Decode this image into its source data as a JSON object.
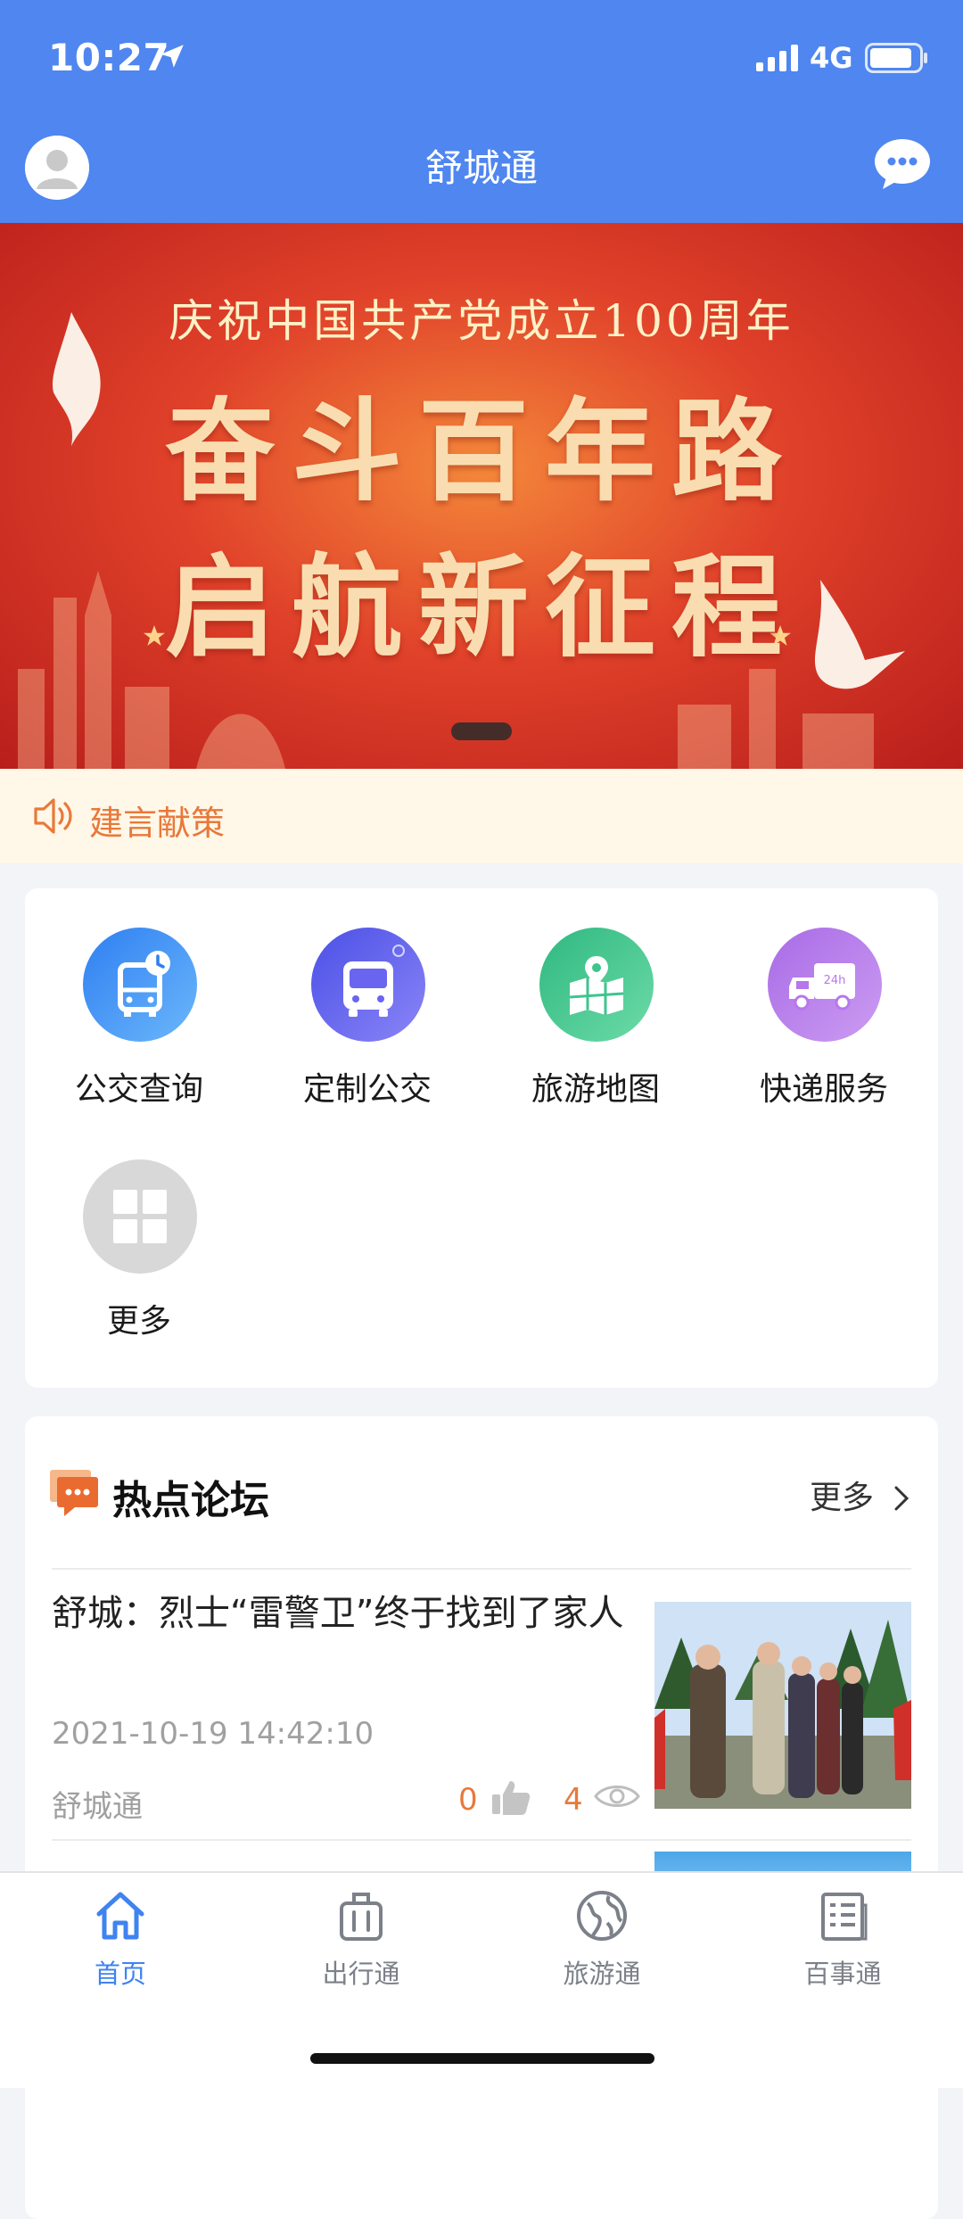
{
  "status_bar": {
    "time": "10:27",
    "network": "4G"
  },
  "header": {
    "title": "舒城通"
  },
  "banner": {
    "subtitle": "庆祝中国共产党成立100周年",
    "line1": "奋斗百年路",
    "line2": "启航新征程"
  },
  "notice": {
    "text": "建言献策"
  },
  "services": [
    {
      "label": "公交查询",
      "icon": "bus-clock-icon",
      "color": "#3d8cf3"
    },
    {
      "label": "定制公交",
      "icon": "bus-icon",
      "color": "#5b63ee"
    },
    {
      "label": "旅游地图",
      "icon": "map-pin-icon",
      "color": "#3dc58f"
    },
    {
      "label": "快递服务",
      "icon": "delivery-truck-icon",
      "color": "#b777ec"
    },
    {
      "label": "更多",
      "icon": "grid-icon",
      "color": "#d8d8d8"
    }
  ],
  "forum": {
    "title": "热点论坛",
    "more": "更多",
    "posts": [
      {
        "title": "舒城：烈士“雷警卫”终于找到了家人",
        "date": "2021-10-19 14:42:10",
        "source": "舒城通",
        "likes": "0",
        "views": "4"
      }
    ]
  },
  "tabs": [
    {
      "label": "首页",
      "icon": "home-icon",
      "active": true
    },
    {
      "label": "出行通",
      "icon": "luggage-icon",
      "active": false
    },
    {
      "label": "旅游通",
      "icon": "globe-icon",
      "active": false
    },
    {
      "label": "百事通",
      "icon": "news-icon",
      "active": false
    }
  ],
  "colors": {
    "header_bg": "#4f86f0",
    "accent_orange": "#e8793a",
    "active_tab": "#3f83f0"
  }
}
